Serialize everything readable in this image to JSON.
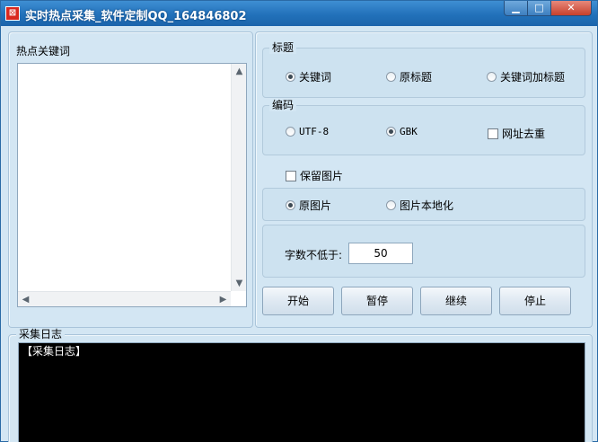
{
  "window": {
    "title": "实时热点采集_软件定制QQ_164846802",
    "controls": {
      "minimize": "▁",
      "maximize": "□",
      "close": "✕"
    }
  },
  "keywords": {
    "label": "热点关键词",
    "scroll_up": "▲",
    "scroll_down": "▼",
    "scroll_left": "◀",
    "scroll_right": "▶"
  },
  "title_group": {
    "legend": "标题",
    "options": [
      {
        "label": "关键词",
        "selected": true
      },
      {
        "label": "原标题",
        "selected": false
      },
      {
        "label": "关键词加标题",
        "selected": false
      }
    ]
  },
  "encoding_group": {
    "legend": "编码",
    "options": [
      {
        "label": "UTF-8",
        "selected": false
      },
      {
        "label": "GBK",
        "selected": true
      }
    ],
    "dedupe_label": "网址去重"
  },
  "image_group": {
    "keep_images_label": "保留图片",
    "options": [
      {
        "label": "原图片",
        "selected": true
      },
      {
        "label": "图片本地化",
        "selected": false
      }
    ]
  },
  "word_count": {
    "label": "字数不低于:",
    "value": "50"
  },
  "buttons": {
    "start": "开始",
    "pause": "暂停",
    "resume": "继续",
    "stop": "停止"
  },
  "log": {
    "label": "采集日志",
    "content": "【采集日志】"
  }
}
